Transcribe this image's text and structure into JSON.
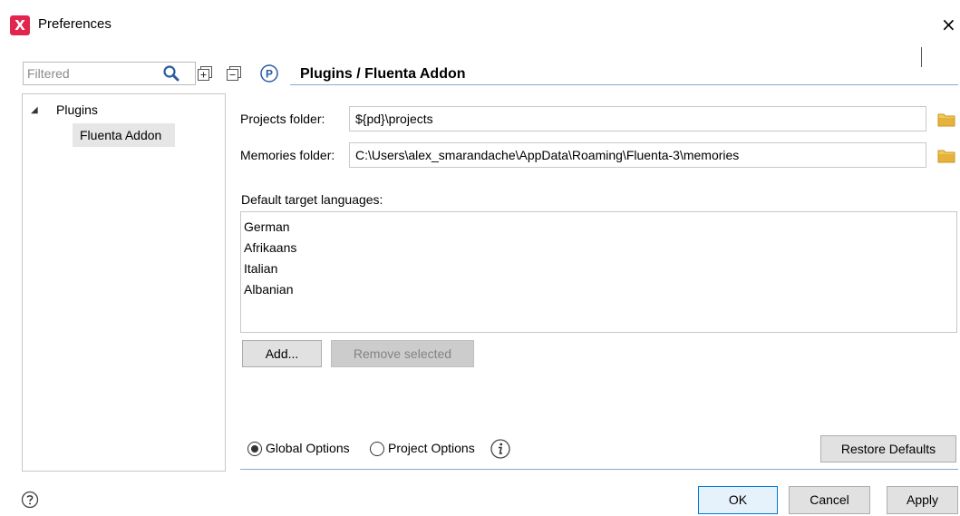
{
  "window": {
    "title": "Preferences",
    "close_glyph": "×",
    "app_icon_glyph": "X"
  },
  "filter": {
    "placeholder": "Filtered",
    "value": ""
  },
  "toolbar": {
    "p_icon_glyph": "P"
  },
  "page": {
    "title": "Plugins / Fluenta Addon"
  },
  "tree": {
    "items": [
      {
        "label": "Plugins",
        "expanded": true
      },
      {
        "label": "Fluenta Addon",
        "selected": true
      }
    ]
  },
  "form": {
    "projects_label": "Projects folder:",
    "projects_value": "${pd}\\projects",
    "memories_label": "Memories folder:",
    "memories_value": "C:\\Users\\alex_smarandache\\AppData\\Roaming\\Fluenta-3\\memories",
    "languages_label": "Default target languages:",
    "languages": [
      "German",
      "Afrikaans",
      "Italian",
      "Albanian"
    ],
    "add_label": "Add...",
    "remove_label": "Remove selected"
  },
  "options": {
    "global_label": "Global Options",
    "project_label": "Project Options",
    "selected": "global",
    "restore_label": "Restore Defaults"
  },
  "footer": {
    "ok_label": "OK",
    "cancel_label": "Cancel",
    "apply_label": "Apply"
  },
  "colors": {
    "accent_line": "#8aa9cf",
    "app_icon": "#e2254f",
    "folder": "#e6b23c",
    "search_icon": "#2a5d9f"
  },
  "icons": [
    "app-icon",
    "close-icon",
    "search-icon",
    "expand-all-icon",
    "collapse-all-icon",
    "p-icon",
    "tree-expanded-arrow-icon",
    "folder-icon",
    "info-icon",
    "help-icon"
  ]
}
